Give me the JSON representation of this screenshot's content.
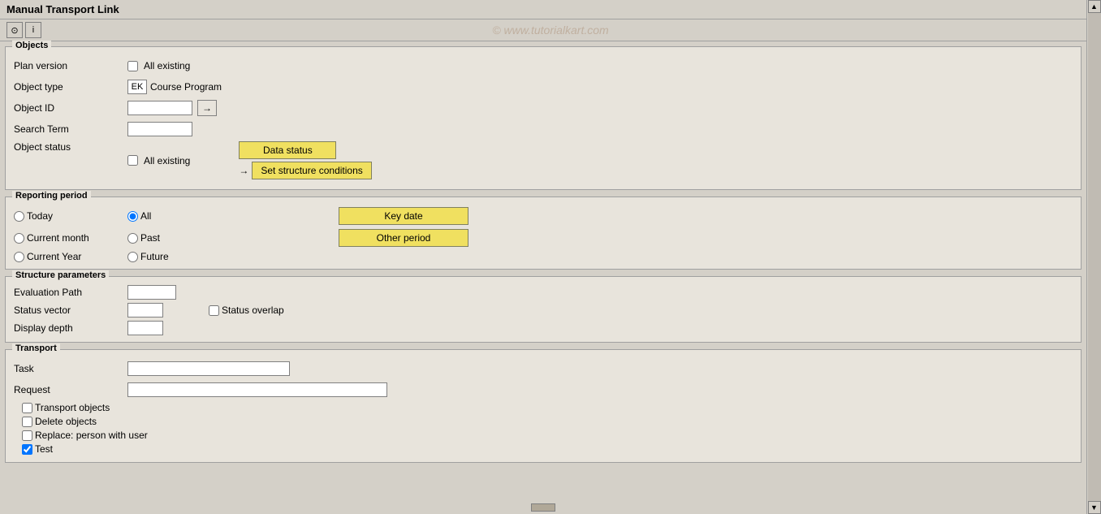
{
  "title": "Manual Transport Link",
  "toolbar": {
    "watermark": "© www.tutorialkart.com"
  },
  "objects_section": {
    "title": "Objects",
    "fields": {
      "plan_version": {
        "label": "Plan version",
        "checkbox_value": "",
        "text": "All existing"
      },
      "object_type": {
        "label": "Object type",
        "value": "EK",
        "text": "Course Program"
      },
      "object_id": {
        "label": "Object ID",
        "value": ""
      },
      "search_term": {
        "label": "Search Term",
        "value": ""
      },
      "object_status": {
        "label": "Object status",
        "checkbox_value": "",
        "text": "All existing"
      }
    },
    "buttons": {
      "data_status": "Data status",
      "arrow_label": "→",
      "set_structure": "Set structure conditions"
    }
  },
  "reporting_section": {
    "title": "Reporting period",
    "radios": {
      "today": "Today",
      "all": "All",
      "current_month": "Current month",
      "past": "Past",
      "current_year": "Current Year",
      "future": "Future"
    },
    "buttons": {
      "key_date": "Key date",
      "other_period": "Other period"
    }
  },
  "structure_section": {
    "title": "Structure parameters",
    "fields": {
      "evaluation_path": {
        "label": "Evaluation Path",
        "value": ""
      },
      "status_vector": {
        "label": "Status vector",
        "value": ""
      },
      "status_overlap": {
        "label": "Status overlap",
        "checked": false
      },
      "display_depth": {
        "label": "Display depth",
        "value": ""
      }
    }
  },
  "transport_section": {
    "title": "Transport",
    "fields": {
      "task": {
        "label": "Task",
        "value": ""
      },
      "request": {
        "label": "Request",
        "value": ""
      }
    },
    "checkboxes": {
      "transport_objects": {
        "label": "Transport objects",
        "checked": false
      },
      "delete_objects": {
        "label": "Delete objects",
        "checked": false
      },
      "replace_person": {
        "label": "Replace: person with user",
        "checked": false
      },
      "test": {
        "label": "Test",
        "checked": true
      }
    }
  }
}
